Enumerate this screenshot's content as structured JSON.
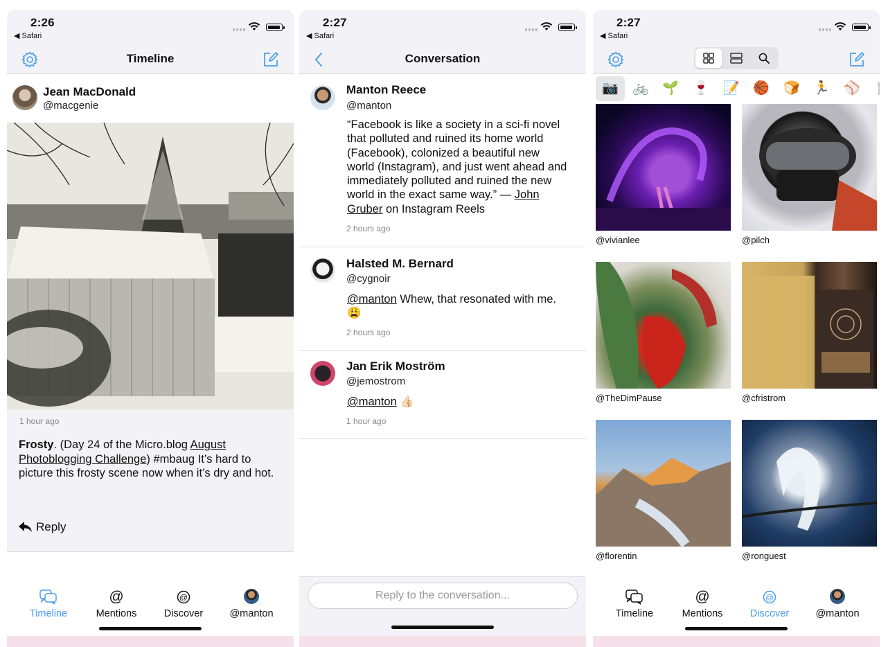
{
  "colors": {
    "accent": "#4a9ee8",
    "nav_bg": "#f2f2f7",
    "divider": "#dddddd",
    "muted_text": "#888888"
  },
  "timeline_screen": {
    "status": {
      "time": "2:26",
      "back_app": "◀ Safari"
    },
    "nav": {
      "title": "Timeline",
      "left_icon": "gear-icon",
      "right_icon": "compose-icon"
    },
    "post": {
      "author_name": "Jean MacDonald",
      "author_handle": "@macgenie",
      "time_ago": "1 hour ago",
      "text_bold": "Frosty",
      "text_1": ". (Day 24 of the Micro.blog ",
      "link": "August Photoblogging Challenge",
      "text_2": ") #mbaug It’s hard to picture this frosty scene now when it’s dry and hot.",
      "reply_label": "Reply"
    },
    "tabs": [
      {
        "label": "Timeline",
        "icon": "chat-bubbles-icon",
        "active": true
      },
      {
        "label": "Mentions",
        "icon": "at-icon",
        "active": false
      },
      {
        "label": "Discover",
        "icon": "discover-at-icon",
        "active": false
      },
      {
        "label": "@manton",
        "icon": "avatar",
        "active": false
      }
    ]
  },
  "conversation_screen": {
    "status": {
      "time": "2:27",
      "back_app": "◀ Safari"
    },
    "nav": {
      "title": "Conversation",
      "left_icon": "chevron-left-icon"
    },
    "messages": [
      {
        "name": "Manton Reece",
        "handle": "@manton",
        "text": "“Facebook is like a society in a sci-fi novel that polluted and ruined its home world (Facebook), colonized a beautiful new world (Instagram), and just went ahead and immediately polluted and ruined the new world in the exact same way.” — ",
        "link": "John Gruber",
        "text_after": " on Instagram Reels",
        "time_ago": "2 hours ago"
      },
      {
        "name": "Halsted M. Bernard",
        "handle": "@cygnoir",
        "mention": "@manton",
        "text": " Whew, that resonated with me. 😩",
        "time_ago": "2 hours ago"
      },
      {
        "name": "Jan Erik Moström",
        "handle": "@jemostrom",
        "mention": "@manton",
        "text": " 👍🏻",
        "time_ago": "1 hour ago"
      }
    ],
    "composer": {
      "placeholder": "Reply to the conversation..."
    }
  },
  "discover_screen": {
    "status": {
      "time": "2:27",
      "back_app": "◀ Safari"
    },
    "nav": {
      "left_icon": "gear-icon",
      "right_icon": "compose-icon",
      "segments": [
        "grid-icon",
        "list-icon",
        "search-icon"
      ],
      "selected_segment": "grid-icon"
    },
    "emoji_topics": [
      "📷",
      "🚲",
      "🌱",
      "🍷",
      "📝",
      "🏀",
      "🍞",
      "🏃",
      "⚾",
      "🍴"
    ],
    "selected_topic": "📷",
    "photos": [
      {
        "user": "@vivianlee"
      },
      {
        "user": "@pilch"
      },
      {
        "user": "@TheDimPause"
      },
      {
        "user": "@cfristrom"
      },
      {
        "user": "@florentin"
      },
      {
        "user": "@ronguest"
      }
    ],
    "tabs": [
      {
        "label": "Timeline",
        "icon": "chat-bubbles-icon",
        "active": false
      },
      {
        "label": "Mentions",
        "icon": "at-icon",
        "active": false
      },
      {
        "label": "Discover",
        "icon": "discover-at-icon",
        "active": true
      },
      {
        "label": "@manton",
        "icon": "avatar",
        "active": false
      }
    ]
  }
}
